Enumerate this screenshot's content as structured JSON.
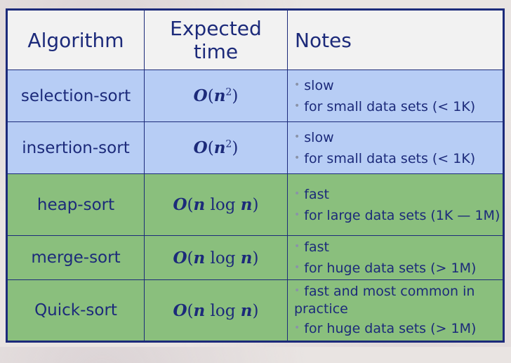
{
  "header": {
    "algorithm": "Algorithm",
    "expected_line1": "Expected",
    "expected_line2": "time",
    "notes": "Notes"
  },
  "rows": [
    {
      "algorithm": "selection-sort",
      "time_O": "O",
      "time_open": "(",
      "time_n": "n",
      "time_exp": "2",
      "time_close": ")",
      "notes": [
        "slow",
        "for small data sets (< 1K)"
      ]
    },
    {
      "algorithm": "insertion-sort",
      "time_O": "O",
      "time_open": "(",
      "time_n": "n",
      "time_exp": "2",
      "time_close": ")",
      "notes": [
        "slow",
        "for small data sets (< 1K)"
      ]
    },
    {
      "algorithm": "heap-sort",
      "time_O": "O",
      "time_open": "(",
      "time_n": "n",
      "time_mid": " log ",
      "time_n2": "n",
      "time_close": ")",
      "notes": [
        "fast",
        "for large data sets (1K — 1M)"
      ]
    },
    {
      "algorithm": "merge-sort",
      "time_O": "O",
      "time_open": "(",
      "time_n": "n",
      "time_mid": " log ",
      "time_n2": "n",
      "time_close": ")",
      "notes": [
        "fast",
        "for huge data sets (> 1M)"
      ]
    },
    {
      "algorithm": "Quick-sort",
      "time_O": "O",
      "time_open": "(",
      "time_n": "n",
      "time_mid": " log ",
      "time_n2": "n",
      "time_close": ")",
      "notes": [
        "fast and most common in",
        "practice",
        "for huge data sets (> 1M)"
      ]
    }
  ],
  "colors": {
    "border": "#1c2a7a",
    "blue_row": "#b7cdf5",
    "green_row": "#8abf7d",
    "header_bg": "#f2f2f2"
  }
}
